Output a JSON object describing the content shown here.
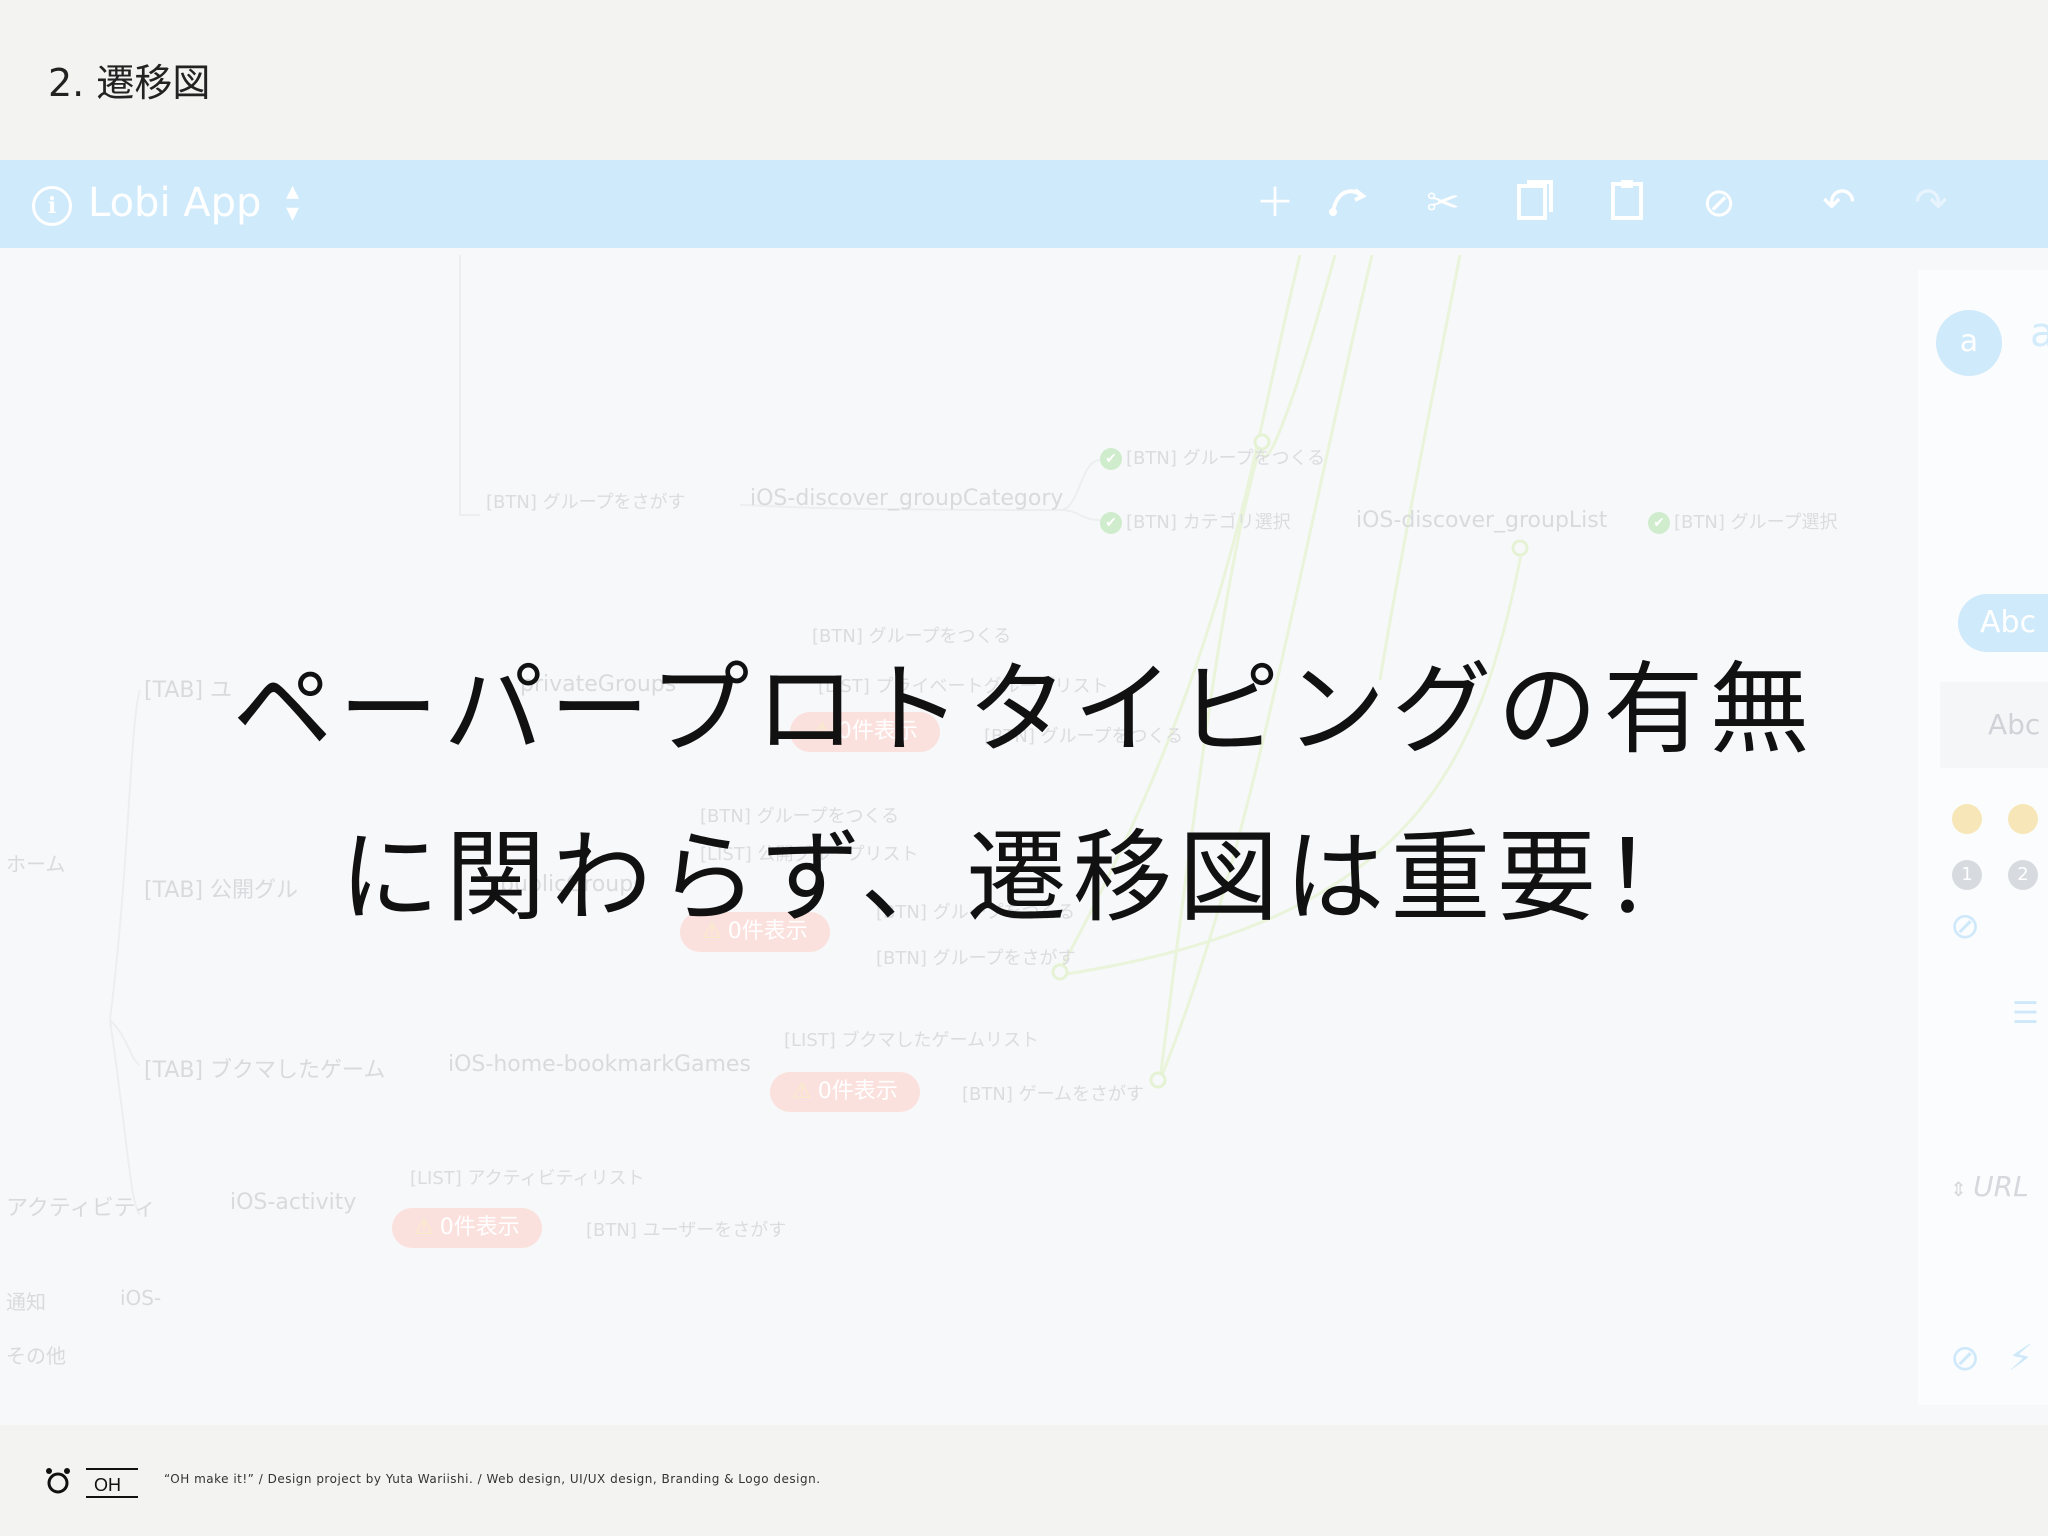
{
  "slide": {
    "header": "2. 遷移図",
    "headline_line1": "ペーパープロトタイピングの有無",
    "headline_line2": "に関わらず、遷移図は重要！"
  },
  "app": {
    "title": "Lobi App",
    "toolbar": {
      "icons": [
        "info-icon",
        "app-switch-icon",
        "add-icon",
        "connect-icon",
        "cut-icon",
        "copy-icon",
        "paste-icon",
        "disable-icon",
        "undo-icon",
        "redo-icon"
      ]
    }
  },
  "flow_map": {
    "nodes_left": [
      "ホーム",
      "アクティビティ",
      "通知",
      "その他"
    ],
    "tabs": [
      "[TAB] ユ",
      "[TAB] 公開グル",
      "[TAB] ブクマしたゲーム"
    ],
    "screens": [
      "iOS-discover_groupCategory",
      "iOS-discover_groupList",
      "iOS-home-bookmarkGames",
      "iOS-activity",
      "iOS-",
      "privateGroups",
      "publicGroups"
    ],
    "buttons": [
      "[BTN] グループをさがす",
      "[BTN] グループをつくる",
      "[BTN] カテゴリ選択",
      "[BTN] グループ選択",
      "[BTN] グループをつくる",
      "[LIST] プライベートグループリスト",
      "[BTN] グループをつくる",
      "[BTN] グループをつくる",
      "[LIST] 公開グループリスト",
      "[BTN] グループをつくる",
      "[BTN] グループをさがす",
      "[LIST] ブクマしたゲームリスト",
      "[BTN] ゲームをさがす",
      "[LIST] アクティビティリスト",
      "[BTN] ユーザーをさがす"
    ],
    "zero_badge": "0件表示"
  },
  "right_panel": {
    "avatar_letter": "a",
    "avatar_name": "a",
    "style_button": "Abc",
    "style_preview": "Abc",
    "badges": [
      "1",
      "2"
    ],
    "url_label": "URL"
  },
  "footer": {
    "logo_text": "OH",
    "credit": "“OH make it!”  /  Design project by Yuta Wariishi.  /  Web design, UI/UX design, Branding & Logo design."
  },
  "colors": {
    "toolbar_bg": "#cfeafb",
    "slide_bg": "#f3f3f2",
    "headline": "#111111",
    "alert_badge": "#fbe1dd",
    "check_badge": "#cfeccd"
  }
}
